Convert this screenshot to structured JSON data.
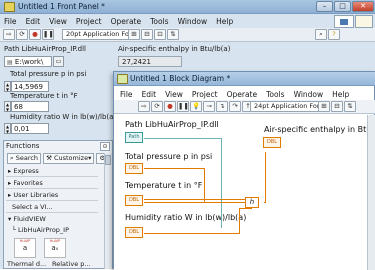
{
  "front_panel": {
    "title": "Untitled 1 Front Panel *",
    "menu": [
      "File",
      "Edit",
      "View",
      "Project",
      "Operate",
      "Tools",
      "Window",
      "Help"
    ],
    "toolbar": {
      "font": "20pt Application Font"
    },
    "path_label": "Path LibHuAirProp_IP.dll",
    "path_value": "E:\\work\\",
    "pressure_label": "Total pressure p in psi",
    "pressure_value": "14,5969",
    "temperature_label": "Temperature t in °F",
    "temperature_value": "68",
    "humidity_label": "Humidity ratio W in lb(w)/lb(a)",
    "humidity_value": "0,01",
    "enthalpy_label": "Air-specific enthalpy in Btu/lb(a)",
    "enthalpy_value": "27,2421"
  },
  "palette": {
    "title": "Functions",
    "search_label": "Search",
    "customize_label": "Customize",
    "items": [
      "Express",
      "Favorites",
      "User Libraries",
      "Select a VI...",
      "FluidVIEW"
    ],
    "sub_item": "LibHuAirProp_IP",
    "icon_labels": [
      "Thermal d...",
      "Relative p..."
    ],
    "icon_glyphs": [
      "a",
      "aᵥ"
    ]
  },
  "block_diagram": {
    "title": "Untitled 1 Block Diagram *",
    "menu": [
      "File",
      "Edit",
      "View",
      "Project",
      "Operate",
      "Tools",
      "Window",
      "Help"
    ],
    "toolbar": {
      "font": "24pt Application Font"
    },
    "path_label": "Path LibHuAirProp_IP.dll",
    "pressure_label": "Total pressure p in psi",
    "temperature_label": "Temperature t in °F",
    "humidity_label": "Humidity ratio W in lb(w)/lb(a)",
    "enthalpy_label": "Air-specific enthalpy in Btu/lb(a)",
    "function_node": "h"
  },
  "colors": {
    "wire": "#e07b00",
    "frame_wire": "#6fb3b3",
    "titlebar": "#97b7d9"
  }
}
